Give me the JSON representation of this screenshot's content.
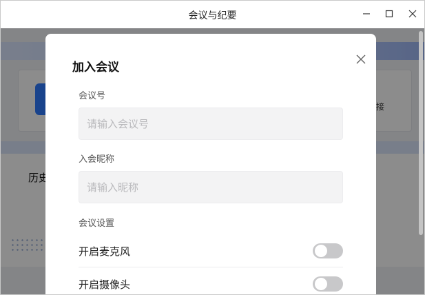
{
  "window": {
    "title": "会议与纪要"
  },
  "background": {
    "left_text": "历史",
    "right_text": "接"
  },
  "dialog": {
    "title": "加入会议",
    "meeting_number": {
      "label": "会议号",
      "placeholder": "请输入会议号",
      "value": ""
    },
    "nickname": {
      "label": "入会昵称",
      "placeholder": "请输入昵称",
      "value": ""
    },
    "settings": {
      "label": "会议设置",
      "microphone": {
        "label": "开启麦克风",
        "enabled": false
      },
      "camera": {
        "label": "开启摄像头",
        "enabled": false
      }
    }
  },
  "icons": {
    "minimize": "minimize-icon",
    "maximize": "maximize-icon",
    "close_window": "close-icon",
    "close_dialog": "close-icon"
  }
}
